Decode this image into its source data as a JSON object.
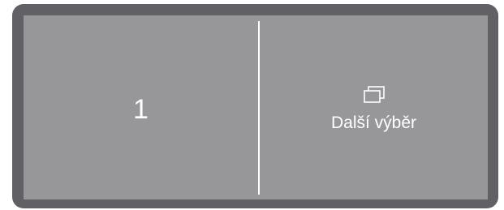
{
  "display": {
    "left_panel": {
      "value": "1"
    },
    "right_panel": {
      "icon": "windows-stack-icon",
      "label": "Další výběr"
    }
  },
  "colors": {
    "frame": "#616165",
    "screen": "#97979a",
    "text": "#ffffff"
  }
}
